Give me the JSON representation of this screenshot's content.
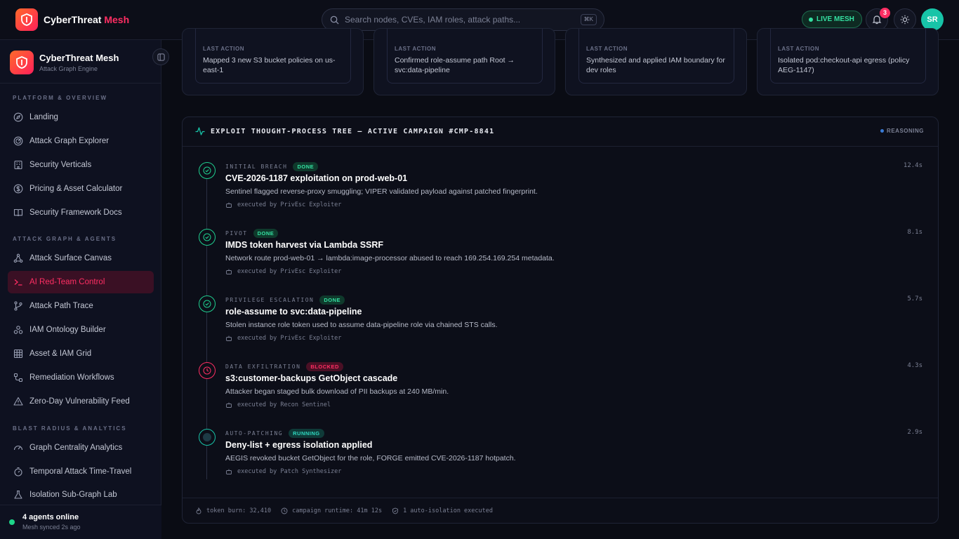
{
  "app": {
    "name": "CyberThreat",
    "name_accent": "Mesh",
    "full_name": "CyberThreat Mesh",
    "subtitle": "Attack Graph Engine"
  },
  "header": {
    "search_placeholder": "Search nodes, CVEs, IAM roles, attack paths...",
    "search_shortcut": "⌘K",
    "live_label": "LIVE MESH",
    "notification_count": "3",
    "avatar_initials": "SR"
  },
  "sidebar": {
    "sections": [
      {
        "title": "PLATFORM & OVERVIEW",
        "items": [
          {
            "label": "Landing",
            "icon": "compass-icon"
          },
          {
            "label": "Attack Graph Explorer",
            "icon": "radar-icon"
          },
          {
            "label": "Security Verticals",
            "icon": "building-icon"
          },
          {
            "label": "Pricing & Asset Calculator",
            "icon": "dollar-icon"
          },
          {
            "label": "Security Framework Docs",
            "icon": "book-icon"
          }
        ]
      },
      {
        "title": "ATTACK GRAPH & AGENTS",
        "items": [
          {
            "label": "Attack Surface Canvas",
            "icon": "network-icon"
          },
          {
            "label": "AI Red-Team Control",
            "icon": "terminal-icon",
            "active": true
          },
          {
            "label": "Attack Path Trace",
            "icon": "git-branch-icon"
          },
          {
            "label": "IAM Ontology Builder",
            "icon": "nodes-icon"
          },
          {
            "label": "Asset & IAM Grid",
            "icon": "grid-icon"
          },
          {
            "label": "Remediation Workflows",
            "icon": "workflow-icon"
          },
          {
            "label": "Zero-Day Vulnerability Feed",
            "icon": "alert-triangle-icon"
          }
        ]
      },
      {
        "title": "BLAST RADIUS & ANALYTICS",
        "items": [
          {
            "label": "Graph Centrality Analytics",
            "icon": "gauge-icon"
          },
          {
            "label": "Temporal Attack Time-Travel",
            "icon": "timer-icon"
          },
          {
            "label": "Isolation Sub-Graph Lab",
            "icon": "flask-icon"
          }
        ]
      }
    ],
    "footer": {
      "status": "4 agents online",
      "sync": "Mesh synced 2s ago"
    }
  },
  "agent_cards": [
    {
      "label": "LAST ACTION",
      "text": "Mapped 3 new S3 bucket policies on us-east-1"
    },
    {
      "label": "LAST ACTION",
      "text": "Confirmed role-assume path Root → svc:data-pipeline"
    },
    {
      "label": "LAST ACTION",
      "text": "Synthesized and applied IAM boundary for dev roles"
    },
    {
      "label": "LAST ACTION",
      "text": "Isolated pod:checkout-api egress (policy AEG-1147)"
    }
  ],
  "tree": {
    "title": "EXPLOIT THOUGHT-PROCESS TREE — ACTIVE CAMPAIGN #CMP-8841",
    "status": "REASONING",
    "steps": [
      {
        "phase": "INITIAL BREACH",
        "status": "DONE",
        "status_key": "done",
        "title": "CVE-2026-1187 exploitation on prod-web-01",
        "desc": "Sentinel flagged reverse-proxy smuggling; VIPER validated payload against patched fingerprint.",
        "exec": "executed by PrivEsc Exploiter",
        "time": "12.4s"
      },
      {
        "phase": "PIVOT",
        "status": "DONE",
        "status_key": "done",
        "title": "IMDS token harvest via Lambda SSRF",
        "desc": "Network route prod-web-01 → lambda:image-processor abused to reach 169.254.169.254 metadata.",
        "exec": "executed by PrivEsc Exploiter",
        "time": "8.1s"
      },
      {
        "phase": "PRIVILEGE ESCALATION",
        "status": "DONE",
        "status_key": "done",
        "title": "role-assume to svc:data-pipeline",
        "desc": "Stolen instance role token used to assume data-pipeline role via chained STS calls.",
        "exec": "executed by PrivEsc Exploiter",
        "time": "5.7s"
      },
      {
        "phase": "DATA EXFILTRATION",
        "status": "BLOCKED",
        "status_key": "blocked",
        "title": "s3:customer-backups GetObject cascade",
        "desc": "Attacker began staged bulk download of PII backups at 240 MB/min.",
        "exec": "executed by Recon Sentinel",
        "time": "4.3s"
      },
      {
        "phase": "AUTO-PATCHING",
        "status": "RUNNING",
        "status_key": "running",
        "title": "Deny-list + egress isolation applied",
        "desc": "AEGIS revoked bucket GetObject for the role, FORGE emitted CVE-2026-1187 hotpatch.",
        "exec": "executed by Patch Synthesizer",
        "time": "2.9s"
      }
    ],
    "footer": {
      "token_burn": "token burn: 32,410",
      "runtime": "campaign runtime: 41m 12s",
      "isolation": "1 auto-isolation executed"
    }
  },
  "colors": {
    "accent": "#ff2e63",
    "success": "#34e0a1",
    "teal": "#17c4a8",
    "background": "#0a0c14"
  }
}
